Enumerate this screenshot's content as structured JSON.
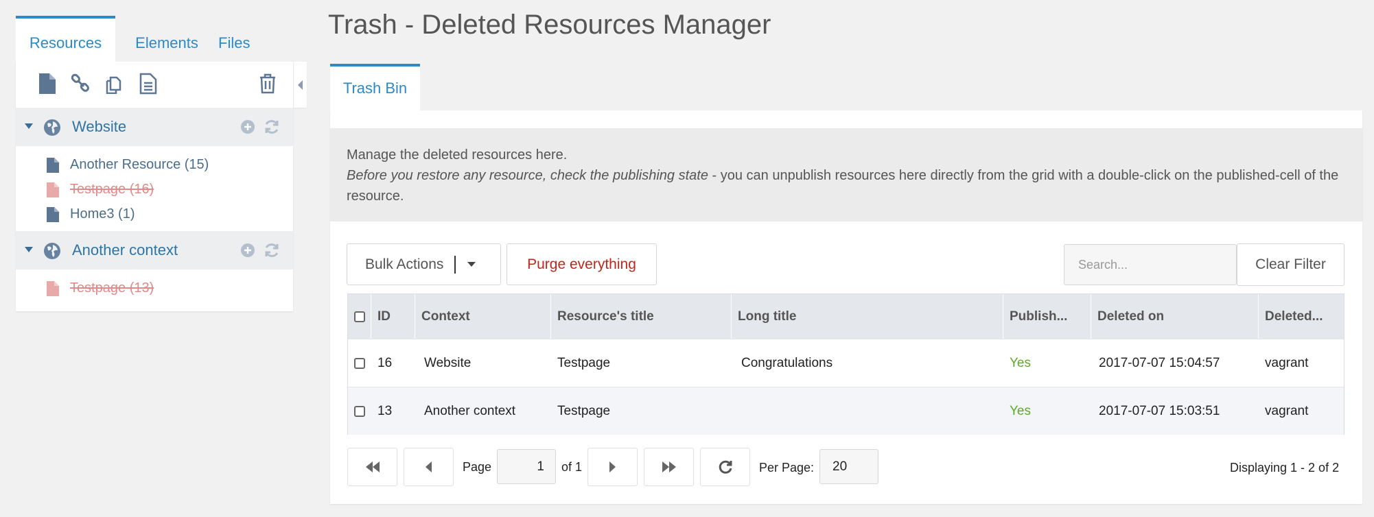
{
  "left_tabs": [
    "Resources",
    "Elements",
    "Files"
  ],
  "tree": {
    "contexts": [
      {
        "label": "Website",
        "resources": [
          {
            "label": "Another Resource (15)",
            "deleted": false
          },
          {
            "label": "Testpage (16)",
            "deleted": true
          },
          {
            "label": "Home3 (1)",
            "deleted": false
          }
        ]
      },
      {
        "label": "Another context",
        "resources": [
          {
            "label": "Testpage (13)",
            "deleted": true
          }
        ]
      }
    ]
  },
  "page_title": "Trash - Deleted Resources Manager",
  "main_tab": "Trash Bin",
  "description": {
    "line1": "Manage the deleted resources here.",
    "emphasis": "Before you restore any resource, check the publishing state",
    "rest": " - you can unpublish resources here directly from the grid with a double-click on the published-cell of the resource."
  },
  "toolbar": {
    "bulk_label": "Bulk Actions",
    "purge_label": "Purge everything",
    "search_placeholder": "Search...",
    "clear_label": "Clear Filter"
  },
  "grid": {
    "columns": [
      "ID",
      "Context",
      "Resource's title",
      "Long title",
      "Publish...",
      "Deleted on",
      "Deleted..."
    ],
    "rows": [
      {
        "id": "16",
        "context": "Website",
        "title": "Testpage",
        "longtitle": "Congratulations",
        "published": "Yes",
        "deletedon": "2017-07-07 15:04:57",
        "deletedby": "vagrant"
      },
      {
        "id": "13",
        "context": "Another context",
        "title": "Testpage",
        "longtitle": "",
        "published": "Yes",
        "deletedon": "2017-07-07 15:03:51",
        "deletedby": "vagrant"
      }
    ]
  },
  "pager": {
    "page_label": "Page",
    "page_value": "1",
    "of_label": "of 1",
    "per_page_label": "Per Page:",
    "per_page_value": "20",
    "displaying": "Displaying 1 - 2 of 2"
  },
  "colors": {
    "accent": "#2a8bc8",
    "danger": "#c0261b",
    "success": "#5cab2a",
    "deleted": "#e08a8a"
  }
}
